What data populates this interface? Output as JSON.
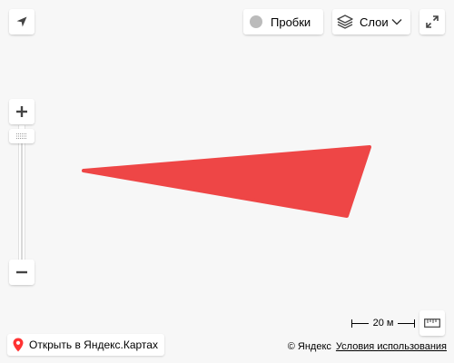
{
  "map": {
    "polygon_color": "#ee4646",
    "background_color": "#f7f7f7"
  },
  "controls": {
    "traffic_label": "Пробки",
    "layers_label": "Слои",
    "open_in_maps_label": "Открыть в Яндекс.Картах",
    "scale_label": "20 м",
    "copyright_label": "© Яндекс",
    "terms_label": "Условия использования"
  },
  "icons": {
    "geolocation": "navigation-arrow-icon",
    "traffic": "traffic-circle-icon",
    "layers": "layers-stack-icon",
    "dropdown": "chevron-down-icon",
    "fullscreen": "expand-arrows-icon",
    "zoom_in": "plus-icon",
    "zoom_out": "minus-icon",
    "ruler": "ruler-icon",
    "pin": "map-pin-icon"
  }
}
